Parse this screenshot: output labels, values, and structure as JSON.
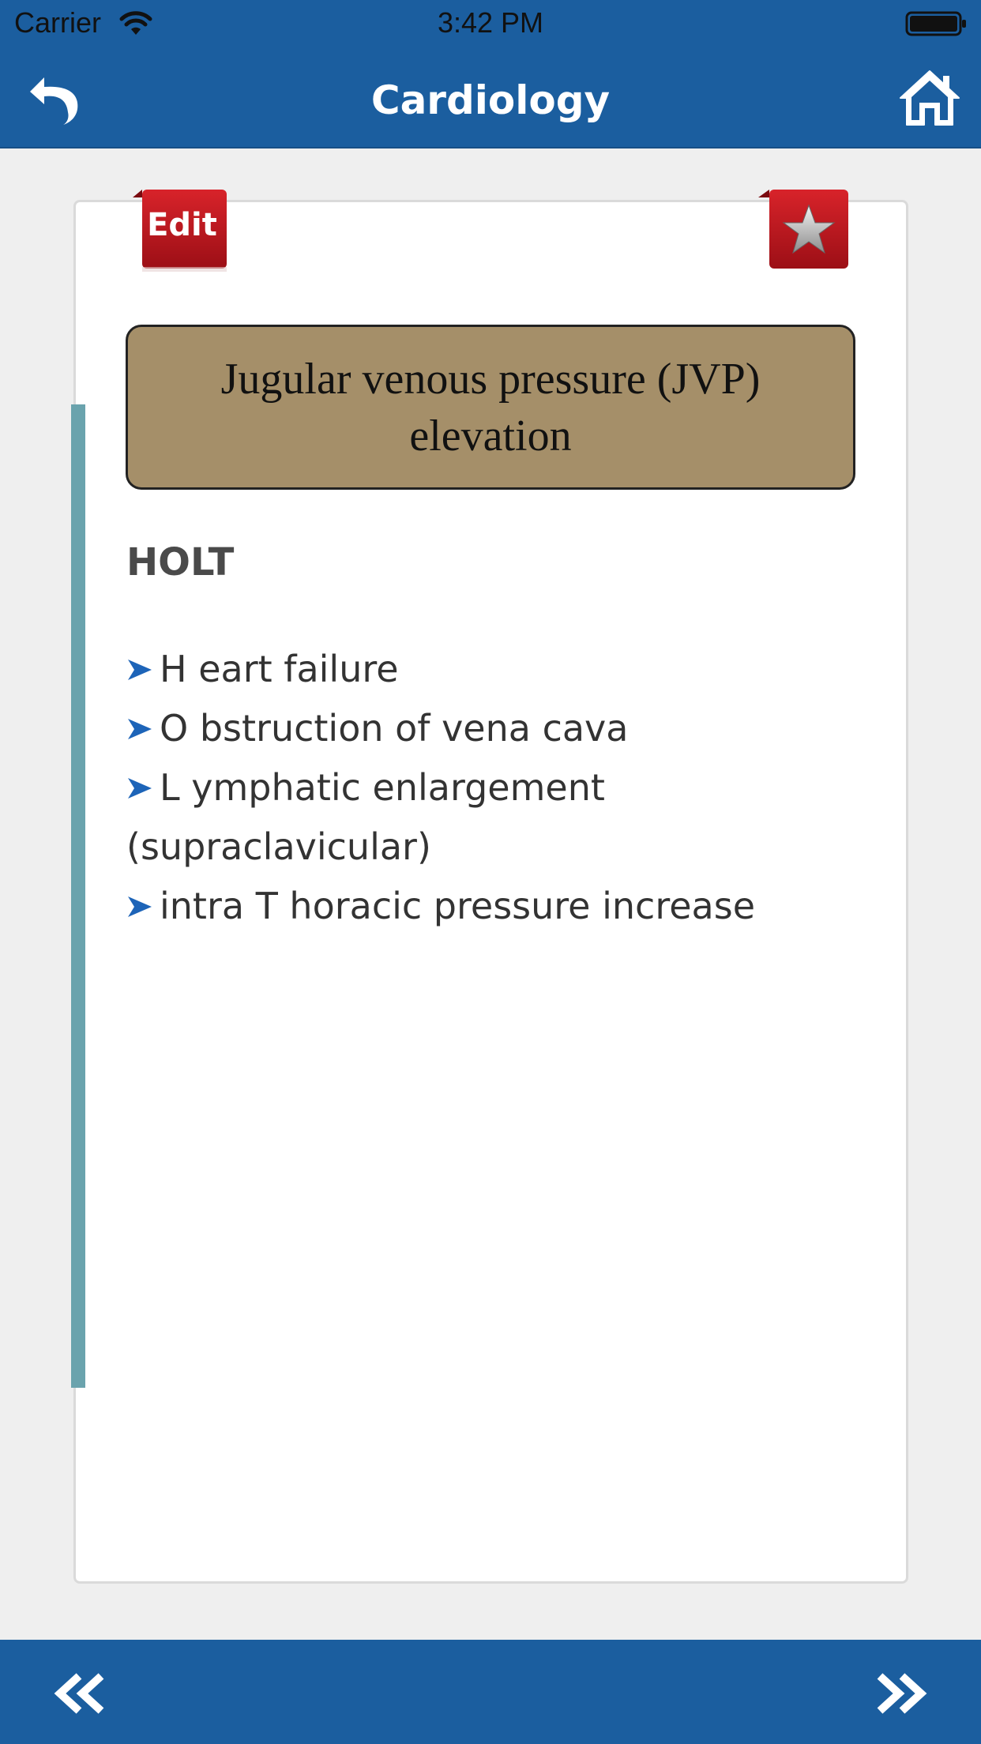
{
  "status_bar": {
    "carrier": "Carrier",
    "time": "3:42 PM",
    "icons": [
      "wifi-icon",
      "battery-icon"
    ]
  },
  "nav": {
    "title": "Cardiology",
    "back_icon": "back-arrow-icon",
    "home_icon": "home-icon"
  },
  "card": {
    "edit_label": "Edit",
    "favorite_icon": "star-icon",
    "topic_title": "Jugular venous pressure (JVP) elevation",
    "mnemonic": "HOLT",
    "items": [
      {
        "text": "H eart failure"
      },
      {
        "text": "O bstruction of vena cava"
      },
      {
        "text": "L ymphatic enlargement (supraclavicular)"
      },
      {
        "text": "intra T horacic pressure increase"
      }
    ]
  },
  "bottom_bar": {
    "prev_icon": "double-chevron-left-icon",
    "next_icon": "double-chevron-right-icon"
  },
  "colors": {
    "primary": "#1b5e9f",
    "title_box": "#a58f69",
    "accent": "#6aa3ad",
    "tab_red": "#b5121b"
  }
}
